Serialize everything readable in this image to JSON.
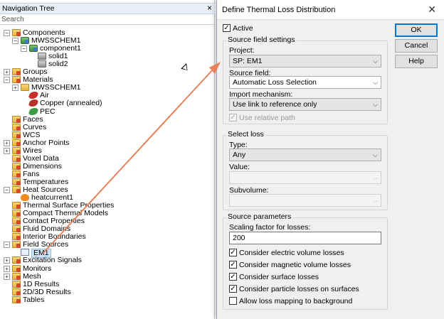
{
  "nav": {
    "title": "Navigation Tree",
    "close": "×",
    "search_placeholder": "Search",
    "items": [
      {
        "label": "Components",
        "level": 0,
        "exp": "−",
        "icon": "folder"
      },
      {
        "label": "MWSSCHEM1",
        "level": 1,
        "exp": "−",
        "icon": "comp"
      },
      {
        "label": "component1",
        "level": 2,
        "exp": "−",
        "icon": "comp"
      },
      {
        "label": "solid1",
        "level": 3,
        "exp": "",
        "icon": "solid"
      },
      {
        "label": "solid2",
        "level": 3,
        "exp": "",
        "icon": "solid"
      },
      {
        "label": "Groups",
        "level": 0,
        "exp": "+",
        "icon": "folder"
      },
      {
        "label": "Materials",
        "level": 0,
        "exp": "−",
        "icon": "folder"
      },
      {
        "label": "MWSSCHEM1",
        "level": 1,
        "exp": "+",
        "icon": "folder-plain"
      },
      {
        "label": "Air",
        "level": 2,
        "exp": "",
        "icon": "mat-air"
      },
      {
        "label": "Copper (annealed)",
        "level": 2,
        "exp": "",
        "icon": "mat-cu"
      },
      {
        "label": "PEC",
        "level": 2,
        "exp": "",
        "icon": "mat-pec"
      },
      {
        "label": "Faces",
        "level": 0,
        "exp": "",
        "icon": "folder"
      },
      {
        "label": "Curves",
        "level": 0,
        "exp": "",
        "icon": "folder"
      },
      {
        "label": "WCS",
        "level": 0,
        "exp": "",
        "icon": "folder"
      },
      {
        "label": "Anchor Points",
        "level": 0,
        "exp": "+",
        "icon": "folder"
      },
      {
        "label": "Wires",
        "level": 0,
        "exp": "+",
        "icon": "folder"
      },
      {
        "label": "Voxel Data",
        "level": 0,
        "exp": "",
        "icon": "folder"
      },
      {
        "label": "Dimensions",
        "level": 0,
        "exp": "",
        "icon": "folder"
      },
      {
        "label": "Fans",
        "level": 0,
        "exp": "",
        "icon": "folder"
      },
      {
        "label": "Temperatures",
        "level": 0,
        "exp": "",
        "icon": "folder"
      },
      {
        "label": "Heat Sources",
        "level": 0,
        "exp": "−",
        "icon": "folder"
      },
      {
        "label": "heatcurrent1",
        "level": 1,
        "exp": "",
        "icon": "heat"
      },
      {
        "label": "Thermal Surface Properties",
        "level": 0,
        "exp": "",
        "icon": "folder"
      },
      {
        "label": "Compact Thermal Models",
        "level": 0,
        "exp": "",
        "icon": "folder"
      },
      {
        "label": "Contact Properties",
        "level": 0,
        "exp": "",
        "icon": "folder"
      },
      {
        "label": "Fluid Domains",
        "level": 0,
        "exp": "",
        "icon": "folder"
      },
      {
        "label": "Interior Boundaries",
        "level": 0,
        "exp": "",
        "icon": "folder"
      },
      {
        "label": "Field Sources",
        "level": 0,
        "exp": "−",
        "icon": "folder"
      },
      {
        "label": "EM1",
        "level": 1,
        "exp": "",
        "icon": "em",
        "selected": true
      },
      {
        "label": "Excitation Signals",
        "level": 0,
        "exp": "+",
        "icon": "folder"
      },
      {
        "label": "Monitors",
        "level": 0,
        "exp": "+",
        "icon": "folder"
      },
      {
        "label": "Mesh",
        "level": 0,
        "exp": "+",
        "icon": "folder"
      },
      {
        "label": "1D Results",
        "level": 0,
        "exp": "",
        "icon": "folder"
      },
      {
        "label": "2D/3D Results",
        "level": 0,
        "exp": "",
        "icon": "folder"
      },
      {
        "label": "Tables",
        "level": 0,
        "exp": "",
        "icon": "folder"
      }
    ]
  },
  "dialog": {
    "title": "Define Thermal Loss Distribution",
    "close": "✕",
    "active_label": "Active",
    "active_checked": true,
    "buttons": {
      "ok": "OK",
      "cancel": "Cancel",
      "help": "Help"
    },
    "source_field_settings": {
      "title": "Source field settings",
      "project_label": "Project:",
      "project_value": "SP: EM1",
      "source_field_label": "Source field:",
      "source_field_value": "Automatic Loss Selection",
      "import_label": "Import mechanism:",
      "import_value": "Use link to reference only",
      "relative_path_label": "Use relative path",
      "relative_path_checked": true
    },
    "select_loss": {
      "title": "Select loss",
      "type_label": "Type:",
      "type_value": "Any",
      "value_label": "Value:",
      "value_value": "",
      "subvolume_label": "Subvolume:",
      "subvolume_value": ""
    },
    "source_parameters": {
      "title": "Source parameters",
      "scaling_label": "Scaling factor for losses:",
      "scaling_value": "200",
      "options": [
        {
          "label": "Consider electric volume losses",
          "checked": true
        },
        {
          "label": "Consider magnetic volume losses",
          "checked": true
        },
        {
          "label": "Consider surface losses",
          "checked": true
        },
        {
          "label": "Consider particle losses on surfaces",
          "checked": true
        },
        {
          "label": "Allow loss mapping to background",
          "checked": false
        }
      ]
    }
  },
  "colors": {
    "arrow": "#e8805c",
    "accent": "#0078d7",
    "selection": "#cce4f7"
  }
}
